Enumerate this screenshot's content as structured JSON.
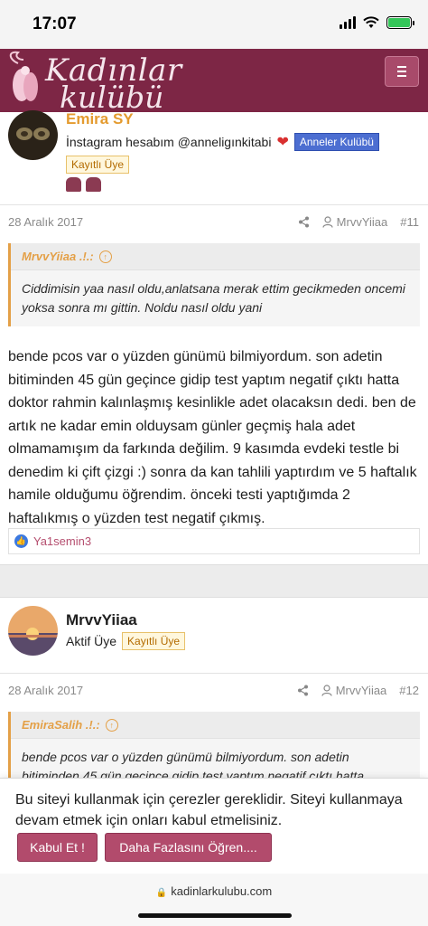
{
  "status": {
    "time": "17:07"
  },
  "header": {
    "logo_line1": "Kadınlar",
    "logo_line2": "kulübü"
  },
  "post1": {
    "username": "Emira SY",
    "signature": "İnstagram hesabım @anneligınkitabi",
    "group_badge": "Anneler Kulübü",
    "rank_badge": "Kayıtlı Üye"
  },
  "post11": {
    "date": "28 Aralık 2017",
    "author": "MrvvYiiaa",
    "number": "#11",
    "quote_author": "MrvvYiiaa .!.:",
    "quote_text": "Ciddimisin yaa nasıl oldu,anlatsana merak ettim gecikmeden oncemi yoksa sonra mı gittin. Noldu nasıl oldu yani",
    "body": "bende pcos var o yüzden günümü bilmiyordum. son adetin bitiminden 45 gün geçince gidip test yaptım negatif çıktı hatta doktor rahmin kalınlaşmış kesinlikle adet olacaksın dedi. ben de artık ne kadar emin olduysam günler geçmiş hala adet olmamamışım da farkında değilim. 9 kasımda evdeki testle bi denedim ki çift çizgi :) sonra da kan tahlili yaptırdım ve 5 haftalık hamile olduğumu öğrendim. önceki testi yaptığımda 2 haftalıkmış o yüzden test negatif çıkmış.",
    "reaction_user": "Ya1semin3"
  },
  "post12": {
    "username": "MrvvYiiaa",
    "title": "Aktif Üye",
    "rank_badge": "Kayıtlı Üye",
    "date": "28 Aralık 2017",
    "author": "MrvvYiiaa",
    "number": "#12",
    "quote_author": "EmiraSalih .!.:",
    "quote_text": "bende pcos var o yüzden günümü bilmiyordum. son adetin bitiminden 45 gün geçince gidip test yaptım negatif çıktı hatta"
  },
  "cookie": {
    "text": "Bu siteyi kullanmak için çerezler gereklidir. Siteyi kullanmaya devam etmek için onları kabul etmelisiniz.",
    "accept_label": "Kabul Et !",
    "learn_label": "Daha Fazlasını Öğren...."
  },
  "browser": {
    "url": "kadinlarkulubu.com"
  },
  "colors": {
    "brand": "#7d2645",
    "accent": "#e4a047",
    "button": "#b24b6c"
  }
}
